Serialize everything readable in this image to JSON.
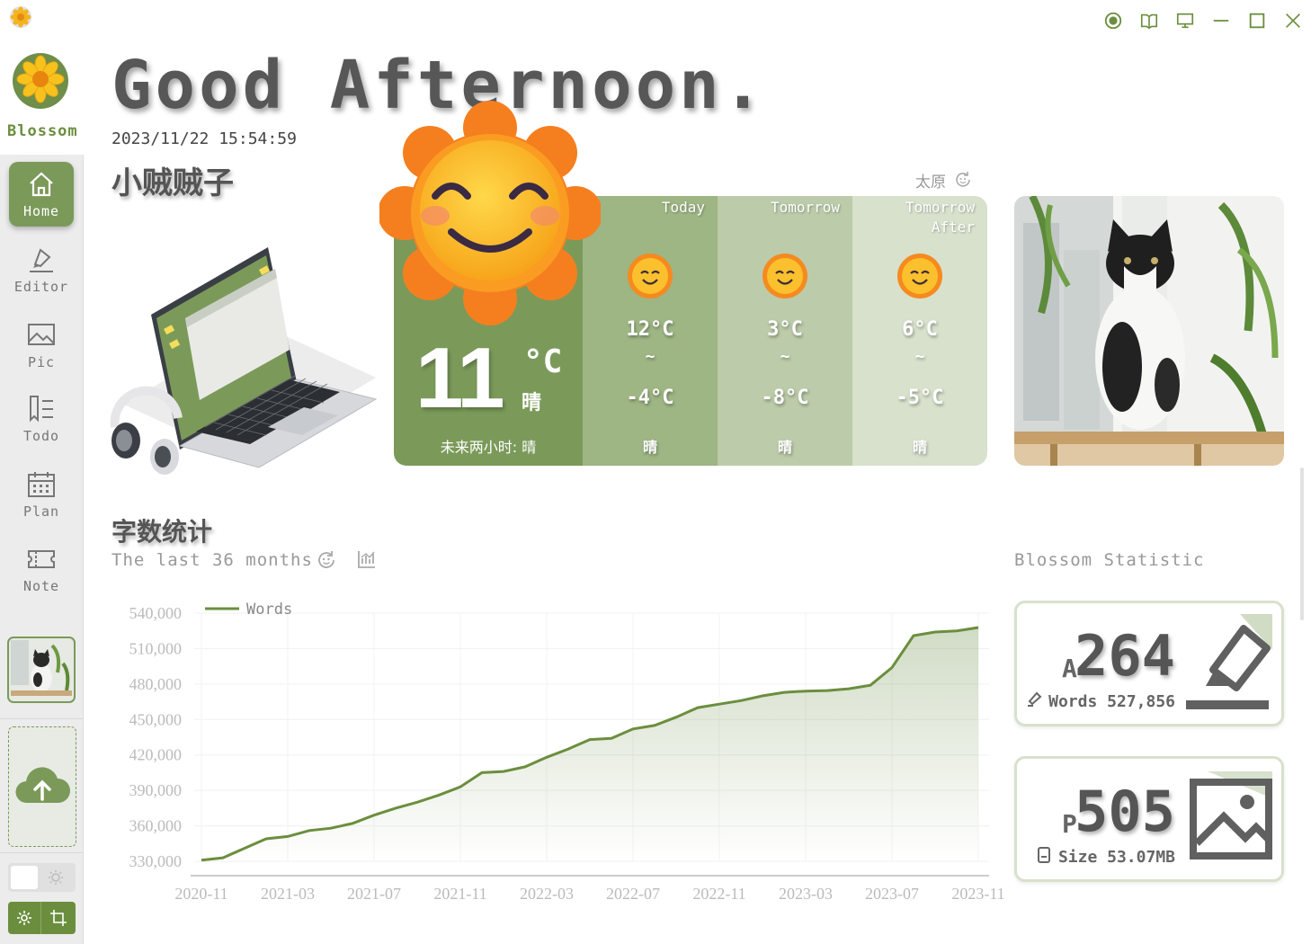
{
  "app": {
    "name": "Blossom"
  },
  "header": {
    "greeting": "Good Afternoon.",
    "datetime": "2023/11/22 15:54:59",
    "username": "小贼贼子"
  },
  "sidebar": {
    "items": [
      {
        "label": "Home",
        "icon": "home-icon",
        "active": true
      },
      {
        "label": "Editor",
        "icon": "editor-icon"
      },
      {
        "label": "Pic",
        "icon": "picture-icon"
      },
      {
        "label": "Todo",
        "icon": "todo-icon"
      },
      {
        "label": "Plan",
        "icon": "calendar-icon"
      },
      {
        "label": "Note",
        "icon": "ticket-icon"
      }
    ]
  },
  "weather": {
    "city": "太原",
    "now": {
      "temp": "11",
      "unit": "°C",
      "cond": "晴",
      "forecast_label": "未来两小时: 晴"
    },
    "days": [
      {
        "label": "Today",
        "high": "12°C",
        "sep": "~",
        "low": "-4°C",
        "cond": "晴"
      },
      {
        "label": "Tomorrow",
        "high": "3°C",
        "sep": "~",
        "low": "-8°C",
        "cond": "晴"
      },
      {
        "label": "Tomorrow After",
        "high": "6°C",
        "sep": "~",
        "low": "-5°C",
        "cond": "晴"
      }
    ]
  },
  "stats_section": {
    "title": "字数统计",
    "subtitle": "The last 36 months",
    "right_title": "Blossom Statistic"
  },
  "cards": {
    "articles": {
      "prefix": "A",
      "value": "264",
      "meta": "Words 527,856"
    },
    "pictures": {
      "prefix": "P",
      "value": "505",
      "meta": "Size 53.07MB"
    }
  },
  "colors": {
    "accent": "#7b9a5a",
    "accent_mid": "#9eb584",
    "accent_light": "#bccba9",
    "accent_pale": "#d7e1cc"
  },
  "chart_data": {
    "type": "area",
    "legend": "top-left",
    "series": [
      {
        "name": "Words",
        "color": "#6b8e3e"
      }
    ],
    "xticks": [
      "2020-11",
      "2021-03",
      "2021-07",
      "2021-11",
      "2022-03",
      "2022-07",
      "2022-11",
      "2023-03",
      "2023-07",
      "2023-11"
    ],
    "yticks": [
      330000,
      360000,
      390000,
      420000,
      450000,
      480000,
      510000,
      540000
    ],
    "ytick_labels": [
      "330,000",
      "360,000",
      "390,000",
      "420,000",
      "450,000",
      "480,000",
      "510,000",
      "540,000"
    ],
    "ylim": [
      330000,
      540000
    ],
    "x": [
      "2020-11",
      "2020-12",
      "2021-01",
      "2021-02",
      "2021-03",
      "2021-04",
      "2021-05",
      "2021-06",
      "2021-07",
      "2021-08",
      "2021-09",
      "2021-10",
      "2021-11",
      "2021-12",
      "2022-01",
      "2022-02",
      "2022-03",
      "2022-04",
      "2022-05",
      "2022-06",
      "2022-07",
      "2022-08",
      "2022-09",
      "2022-10",
      "2022-11",
      "2022-12",
      "2023-01",
      "2023-02",
      "2023-03",
      "2023-04",
      "2023-05",
      "2023-06",
      "2023-07",
      "2023-08",
      "2023-09",
      "2023-10",
      "2023-11"
    ],
    "values": [
      331000,
      333000,
      341000,
      349000,
      351000,
      356000,
      358000,
      362000,
      369000,
      375000,
      380000,
      386000,
      393000,
      405000,
      406000,
      410000,
      418000,
      425000,
      433000,
      434000,
      442000,
      445000,
      452000,
      460000,
      463000,
      466000,
      470000,
      473000,
      474000,
      474500,
      476000,
      479000,
      494000,
      521000,
      524000,
      525000,
      527856
    ]
  }
}
